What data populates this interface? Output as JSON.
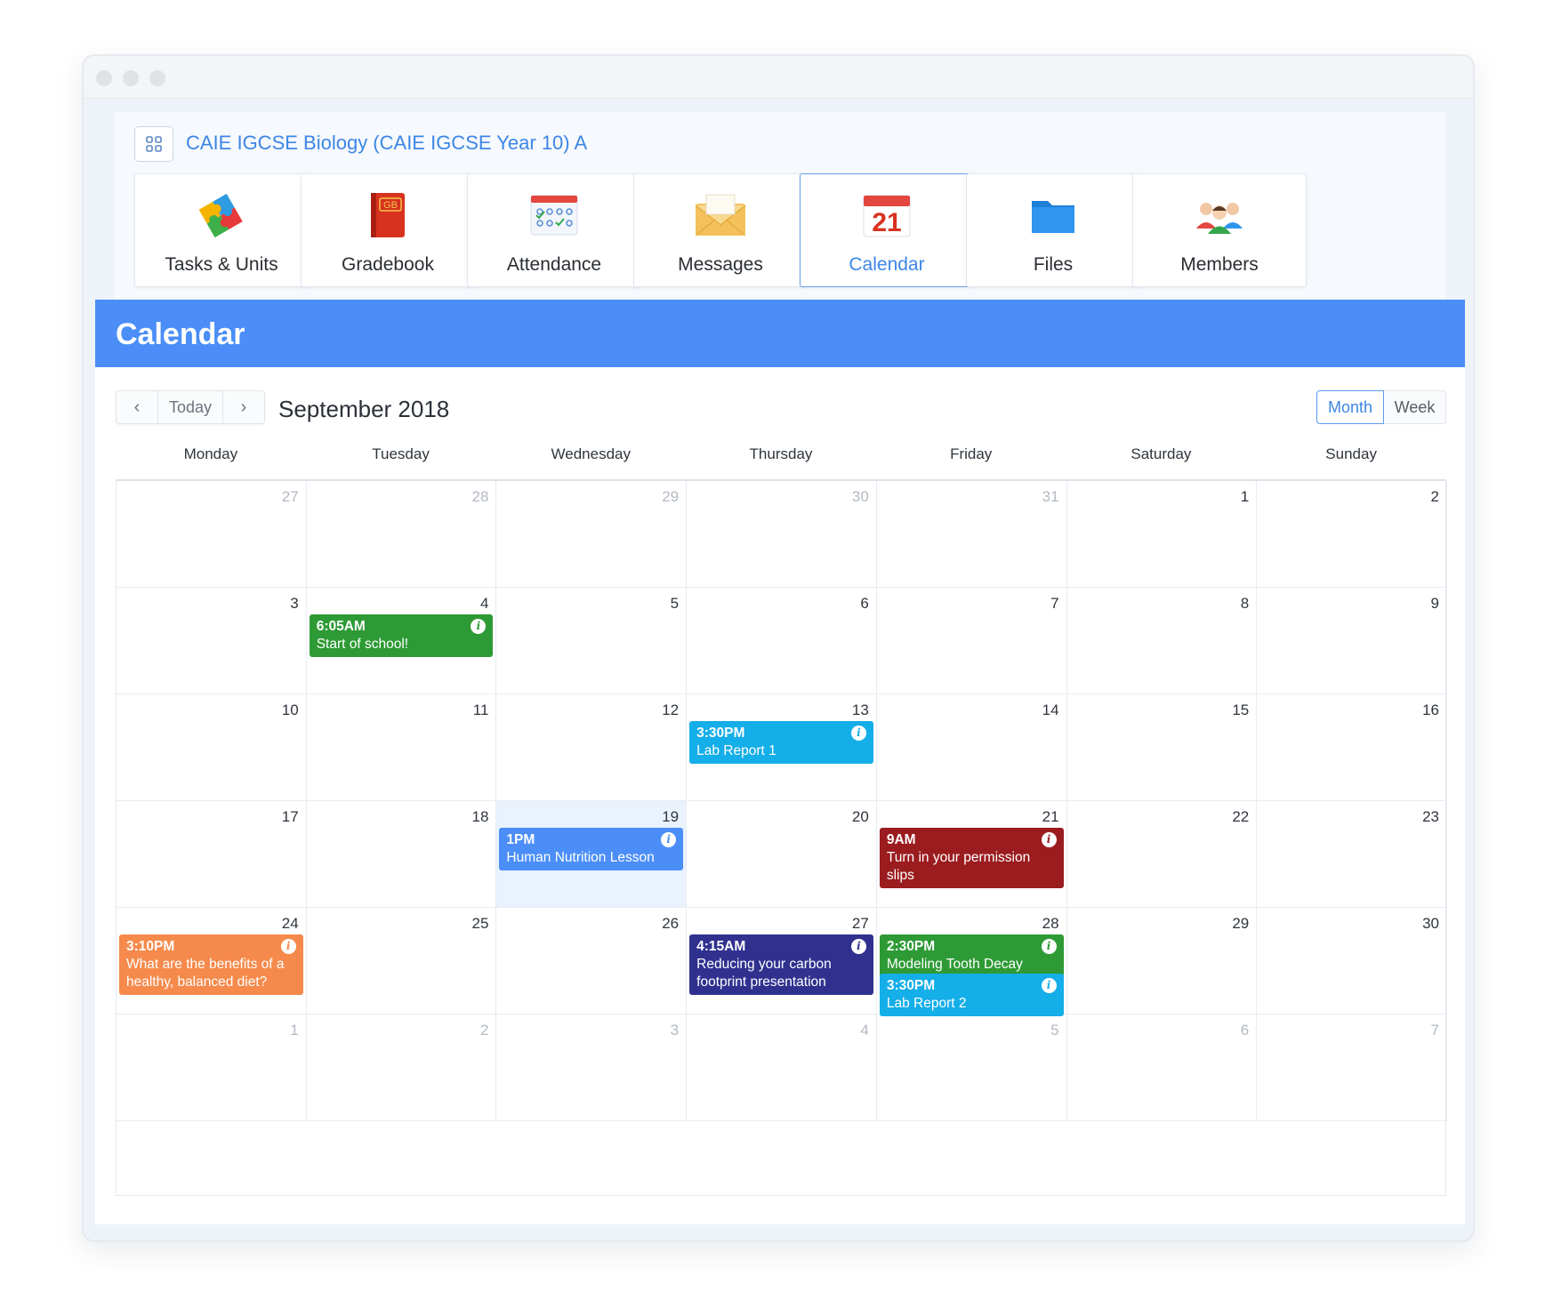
{
  "course": {
    "title": "CAIE IGCSE Biology (CAIE IGCSE Year 10) A",
    "apps_icon": "grid-icon"
  },
  "nav": [
    {
      "label": "Tasks & Units",
      "icon": "puzzle-icon",
      "active": false
    },
    {
      "label": "Gradebook",
      "icon": "gradebook-icon",
      "active": false
    },
    {
      "label": "Attendance",
      "icon": "attendance-icon",
      "active": false
    },
    {
      "label": "Messages",
      "icon": "envelope-icon",
      "active": false
    },
    {
      "label": "Calendar",
      "icon": "calendar-icon",
      "active": true
    },
    {
      "label": "Files",
      "icon": "folder-icon",
      "active": false
    },
    {
      "label": "Members",
      "icon": "members-icon",
      "active": false
    }
  ],
  "gradebook_text": "GB",
  "calendar_icon_day": "21",
  "header": {
    "title": "Calendar"
  },
  "toolbar": {
    "prev": "‹",
    "today": "Today",
    "next": "›",
    "month_title": "September 2018",
    "view_month": "Month",
    "view_week": "Week",
    "active_view": "Month"
  },
  "weekdays": [
    "Monday",
    "Tuesday",
    "Wednesday",
    "Thursday",
    "Friday",
    "Saturday",
    "Sunday"
  ],
  "weeks": [
    [
      {
        "d": "27",
        "o": true
      },
      {
        "d": "28",
        "o": true
      },
      {
        "d": "29",
        "o": true
      },
      {
        "d": "30",
        "o": true
      },
      {
        "d": "31",
        "o": true
      },
      {
        "d": "1"
      },
      {
        "d": "2"
      }
    ],
    [
      {
        "d": "3"
      },
      {
        "d": "4"
      },
      {
        "d": "5"
      },
      {
        "d": "6"
      },
      {
        "d": "7"
      },
      {
        "d": "8"
      },
      {
        "d": "9"
      }
    ],
    [
      {
        "d": "10"
      },
      {
        "d": "11"
      },
      {
        "d": "12"
      },
      {
        "d": "13"
      },
      {
        "d": "14"
      },
      {
        "d": "15"
      },
      {
        "d": "16"
      }
    ],
    [
      {
        "d": "17"
      },
      {
        "d": "18"
      },
      {
        "d": "19",
        "today": true
      },
      {
        "d": "20"
      },
      {
        "d": "21"
      },
      {
        "d": "22"
      },
      {
        "d": "23"
      }
    ],
    [
      {
        "d": "24"
      },
      {
        "d": "25"
      },
      {
        "d": "26"
      },
      {
        "d": "27"
      },
      {
        "d": "28"
      },
      {
        "d": "29"
      },
      {
        "d": "30"
      }
    ],
    [
      {
        "d": "1",
        "o": true
      },
      {
        "d": "2",
        "o": true
      },
      {
        "d": "3",
        "o": true
      },
      {
        "d": "4",
        "o": true
      },
      {
        "d": "5",
        "o": true
      },
      {
        "d": "6",
        "o": true
      },
      {
        "d": "7",
        "o": true
      }
    ]
  ],
  "events": [
    {
      "week": 1,
      "day": 1,
      "slot": 0,
      "time": "6:05AM",
      "title": "Start of school!",
      "color": "#2e9a35"
    },
    {
      "week": 2,
      "day": 3,
      "slot": 0,
      "time": "3:30PM",
      "title": "Lab Report 1",
      "color": "#14aee8"
    },
    {
      "week": 3,
      "day": 2,
      "slot": 0,
      "time": "1PM",
      "title": "Human Nutrition Lesson",
      "color": "#4b8ef7"
    },
    {
      "week": 3,
      "day": 4,
      "slot": 0,
      "time": "9AM",
      "title": "Turn in your permission slips",
      "color": "#9b1c1f"
    },
    {
      "week": 4,
      "day": 0,
      "slot": 0,
      "time": "3:10PM",
      "title": "What are the benefits of a healthy, balanced diet?",
      "color": "#f58a4c"
    },
    {
      "week": 4,
      "day": 3,
      "slot": 0,
      "time": "4:15AM",
      "title": "Reducing your carbon footprint presentation",
      "color": "#30318f"
    },
    {
      "week": 4,
      "day": 4,
      "slot": 0,
      "time": "2:30PM",
      "title": "Modeling Tooth Decay",
      "color": "#2e9a35"
    },
    {
      "week": 4,
      "day": 4,
      "slot": 1,
      "time": "3:30PM",
      "title": "Lab Report 2",
      "color": "#14aee8"
    }
  ],
  "info_glyph": "i"
}
